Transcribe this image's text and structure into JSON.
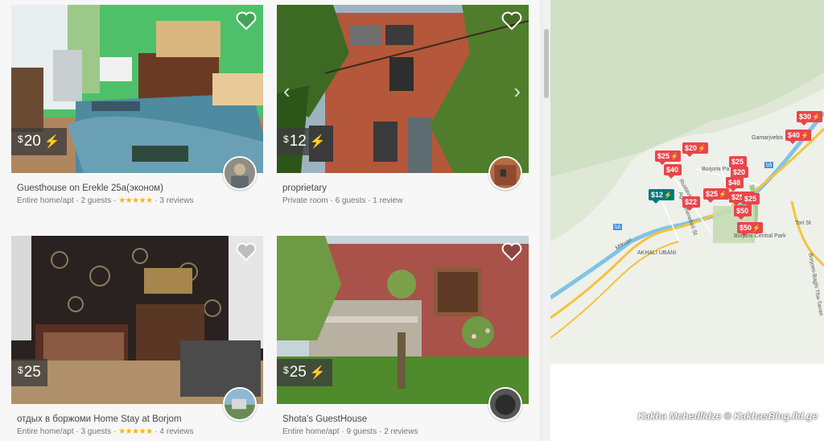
{
  "listings": [
    {
      "currency": "$",
      "price": "20",
      "instant": true,
      "title": "Guesthouse on Erekle 25a(эконом)",
      "room_type": "Entire home/apt",
      "guests": "2 guests",
      "stars": "★★★★★",
      "reviews": "3 reviews"
    },
    {
      "currency": "$",
      "price": "12",
      "instant": true,
      "title": "proprietary",
      "room_type": "Private room",
      "guests": "6 guests",
      "stars": "",
      "reviews": "1 review"
    },
    {
      "currency": "$",
      "price": "25",
      "instant": false,
      "title": "отдых в боржоми Home Stay at Borjom",
      "room_type": "Entire home/apt",
      "guests": "3 guests",
      "stars": "★★★★★",
      "reviews": "4 reviews"
    },
    {
      "currency": "$",
      "price": "25",
      "instant": true,
      "title": "Shota's GuestHouse",
      "room_type": "Entire home/apt",
      "guests": "9 guests",
      "stars": "",
      "reviews": "2 reviews"
    }
  ],
  "separator": " · ",
  "bolt": "⚡",
  "map": {
    "pins": [
      {
        "label": "$30",
        "bolt": "⚡"
      },
      {
        "label": "$40",
        "bolt": "⚡"
      },
      {
        "label": "$20",
        "bolt": "⚡"
      },
      {
        "label": "$25",
        "bolt": "⚡"
      },
      {
        "label": "$40",
        "bolt": ""
      },
      {
        "label": "$25",
        "bolt": ""
      },
      {
        "label": "$20",
        "bolt": ""
      },
      {
        "label": "$48",
        "bolt": ""
      },
      {
        "label": "$12",
        "bolt": "⚡"
      },
      {
        "label": "$22",
        "bolt": ""
      },
      {
        "label": "$25",
        "bolt": "⚡"
      },
      {
        "label": "$25",
        "bolt": "⚡"
      },
      {
        "label": "$25",
        "bolt": ""
      },
      {
        "label": "$50",
        "bolt": ""
      },
      {
        "label": "$50",
        "bolt": "⚡"
      }
    ],
    "street_labels": [
      "Gamarjvebis",
      "Borjomi Pa",
      "Agmashenebeli St",
      "AKHALI UBANI",
      "Mtkvari",
      "Tori St",
      "Borjomi Central Park",
      "Borjomi-Baghi Tba-Tavan",
      "Rustaveli St"
    ],
    "road_badges": [
      "სბ",
      "სბ"
    ],
    "colors": {
      "pin": "#e8464b",
      "pin_selected": "#00787a",
      "road": "#f5c33b",
      "river": "#7ec4e6"
    }
  },
  "watermark": "Kakha Mchedlidze © KakhasBlog.lld.ge"
}
